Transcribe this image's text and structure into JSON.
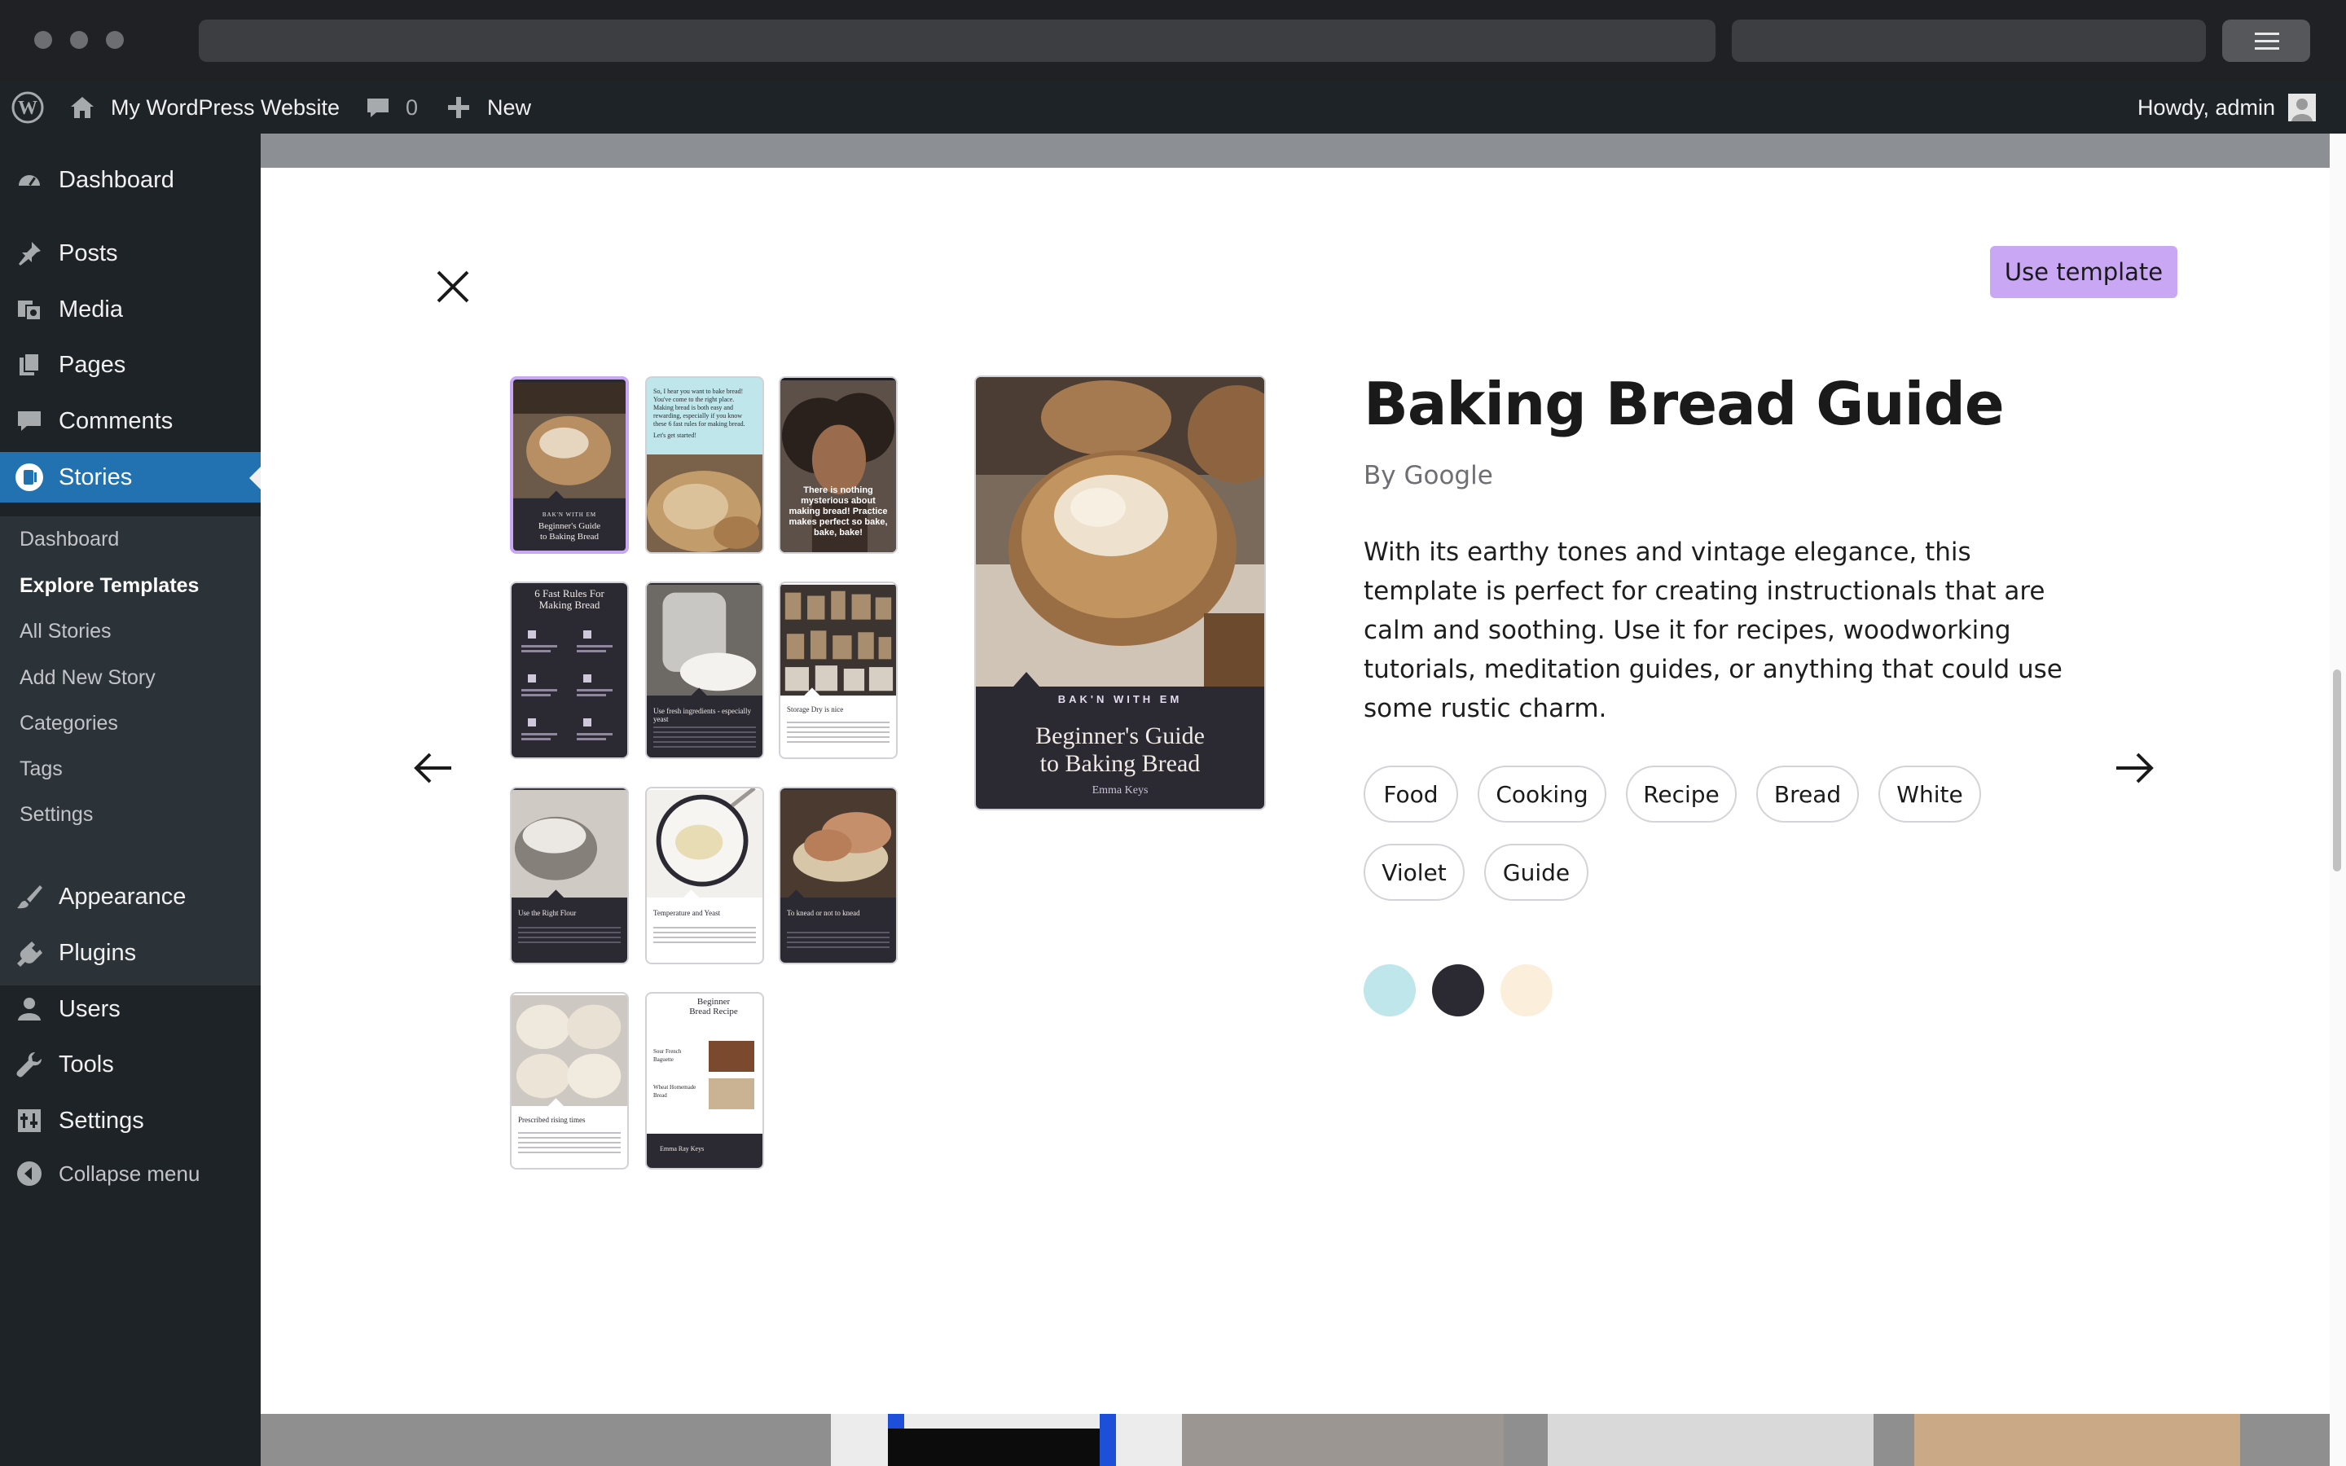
{
  "admin_bar": {
    "site_name": "My WordPress Website",
    "comments_count": "0",
    "new_label": "New",
    "howdy": "Howdy, admin"
  },
  "sidebar": {
    "items": [
      {
        "label": "Dashboard",
        "icon": "dashboard-icon"
      },
      {
        "label": "Posts",
        "icon": "pin-icon"
      },
      {
        "label": "Media",
        "icon": "media-icon"
      },
      {
        "label": "Pages",
        "icon": "pages-icon"
      },
      {
        "label": "Comments",
        "icon": "comment-icon"
      },
      {
        "label": "Stories",
        "icon": "stories-icon",
        "current": true
      },
      {
        "label": "Appearance",
        "icon": "paintbrush-icon"
      },
      {
        "label": "Plugins",
        "icon": "plugin-icon"
      },
      {
        "label": "Users",
        "icon": "user-icon"
      },
      {
        "label": "Tools",
        "icon": "wrench-icon"
      },
      {
        "label": "Settings",
        "icon": "settings-icon"
      }
    ],
    "submenu": [
      {
        "label": "Dashboard"
      },
      {
        "label": "Explore Templates",
        "active": true
      },
      {
        "label": "All Stories"
      },
      {
        "label": "Add New Story"
      },
      {
        "label": "Categories"
      },
      {
        "label": "Tags"
      },
      {
        "label": "Settings"
      }
    ],
    "collapse_label": "Collapse menu"
  },
  "modal": {
    "use_template_label": "Use template",
    "title": "Baking Bread Guide",
    "author": "By Google",
    "description": "With its earthy tones and vintage elegance, this template is perfect for creating instructionals that are calm and soothing. Use it for recipes, woodworking tutorials, meditation guides, or anything that could use some rustic charm.",
    "tags": [
      "Food",
      "Cooking",
      "Recipe",
      "Bread",
      "White",
      "Violet",
      "Guide"
    ],
    "colors": [
      "#bfe6ea",
      "#2b2a33",
      "#fbefdc"
    ],
    "preview": {
      "brand": "BAK'N WITH EM",
      "title_line1": "Beginner's Guide",
      "title_line2": "to Baking Bread",
      "byline": "Emma Keys"
    },
    "thumbnails": {
      "t1_brand": "BAK'N WITH EM",
      "t1_title1": "Beginner's Guide",
      "t1_title2": "to Baking Bread",
      "t2_text": "So, I hear you want to bake bread! You've come to the right place. Making bread is both easy and rewarding, especially if you know these 6 fast rules for making bread.",
      "t2_more": "Let's get started!",
      "t3_quote": "There is nothing mysterious about making bread! Practice makes perfect so bake, bake, bake!",
      "t4_title1": "6 Fast Rules For",
      "t4_title2": "Making Bread",
      "t5_caption": "Use fresh ingredients - especially yeast",
      "t6_caption": "Storage Dry is nice",
      "t7_caption": "Use the Right Flour",
      "t8_caption": "Temperature and Yeast",
      "t9_caption": "To knead or not to knead",
      "t10_caption": "Prescribed rising times",
      "t11_title1": "Beginner",
      "t11_title2": "Bread Recipe",
      "t11_item1": "Sour French Baguette",
      "t11_item2": "Wheat Homemade Bread",
      "t11_footer": "Emma Ray Keys"
    }
  }
}
